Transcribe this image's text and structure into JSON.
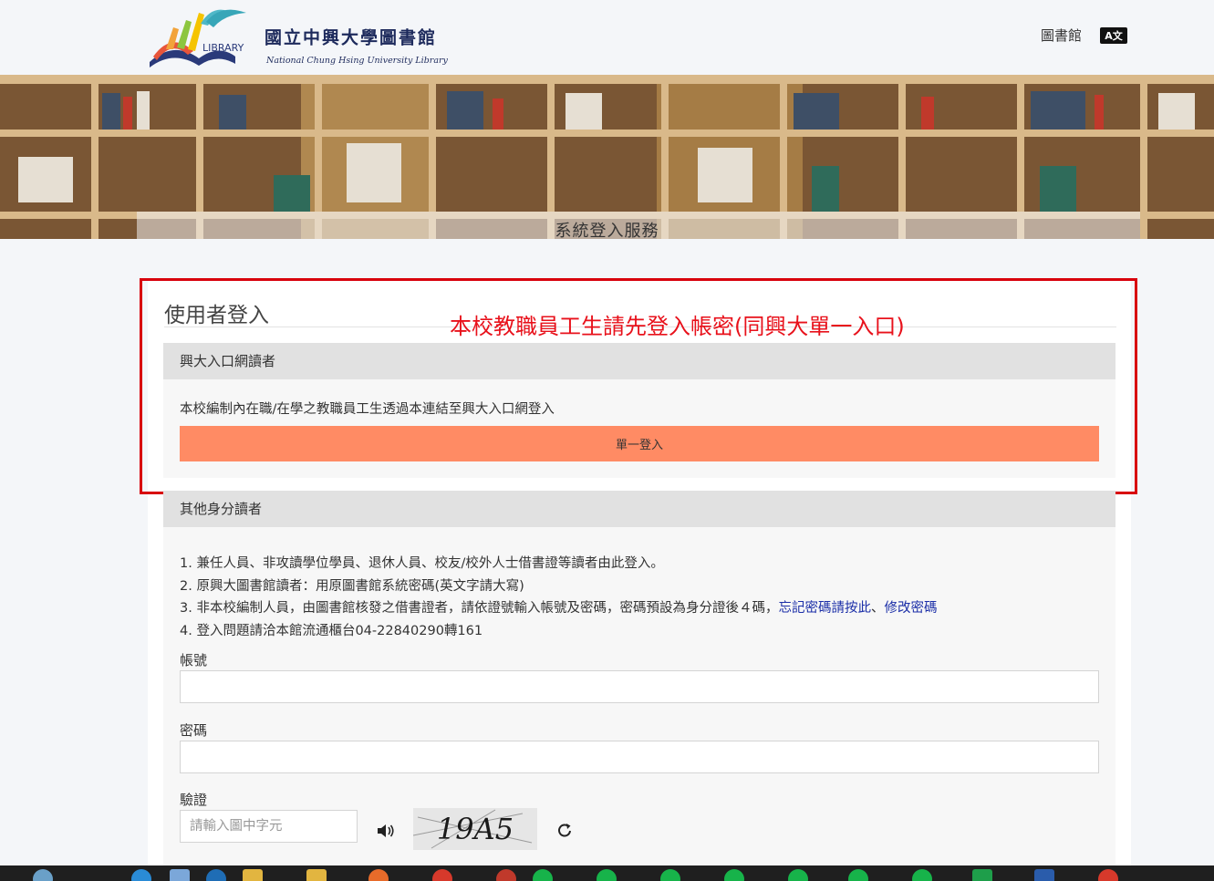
{
  "header": {
    "logo_title": "國立中興大學圖書館",
    "logo_sub": "National Chung Hsing University Library",
    "logo_badge": "LIBRARY",
    "nav_library": "圖書館",
    "lang_icon": "translate-icon"
  },
  "banner": {
    "title": "系統登入服務"
  },
  "login": {
    "title": "使用者登入",
    "annotation": "本校教職員工生請先登入帳密(同興大單一入口)",
    "sso_section": {
      "heading": "興大入口網讀者",
      "description": "本校編制內在職/在學之教職員工生透過本連結至興大入口網登入",
      "button_label": "單一登入"
    },
    "other_section": {
      "heading": "其他身分讀者",
      "notes": [
        "1. 兼任人員、非攻讀學位學員、退休人員、校友/校外人士借書證等讀者由此登入。",
        "2. 原興大圖書館讀者：用原圖書館系統密碼(英文字請大寫)",
        "3. 非本校編制人員，由圖書館核發之借書證者，請依證號輸入帳號及密碼，密碼預設為身分證後４碼，",
        "4. 登入問題請洽本館流通櫃台04-22840290轉161"
      ],
      "forgot_link": "忘記密碼請按此",
      "separator": "、",
      "change_link": "修改密碼",
      "account_label": "帳號",
      "account_value": "",
      "password_label": "密碼",
      "password_value": "",
      "captcha_label": "驗證",
      "captcha_placeholder": "請輸入圖中字元",
      "captcha_text": "19A5"
    }
  },
  "taskbar": {
    "colors": {
      "background": "#1f1f1f"
    }
  },
  "colors": {
    "accent_button": "#ff8b64",
    "annotation_red": "#e8111b",
    "link_blue": "#1c2fa8"
  }
}
